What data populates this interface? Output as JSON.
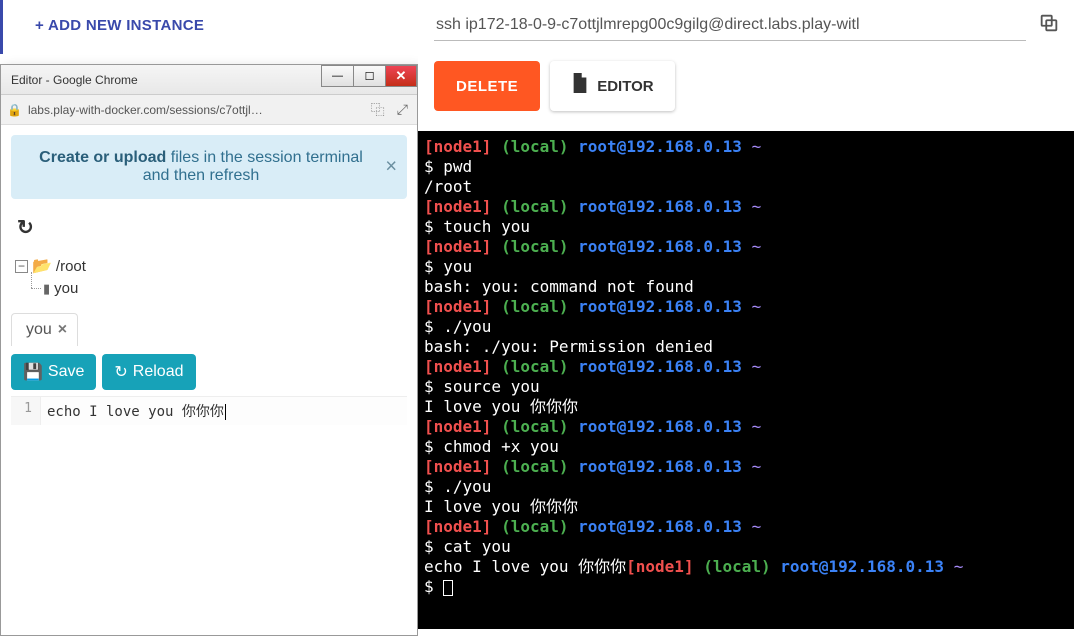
{
  "sidebar": {
    "add_instance": "+ ADD NEW INSTANCE"
  },
  "editor_window": {
    "title": "Editor - Google Chrome",
    "url": "labs.play-with-docker.com/sessions/c7ottjl…",
    "banner_bold": "Create or upload",
    "banner_rest": " files in the session terminal and then refresh",
    "tree_root": "/root",
    "tree_file": "you",
    "tab": "you",
    "save_label": "Save",
    "reload_label": "Reload",
    "line_number": "1",
    "code": "echo I love you 你你你"
  },
  "main": {
    "ssh": "ssh ip172-18-0-9-c7ottjlmrepg00c9gilg@direct.labs.play-witl",
    "delete_label": "DELETE",
    "editor_label": "EDITOR"
  },
  "terminal": {
    "lines": [
      {
        "type": "prompt",
        "node": "[node1]",
        "local": "(local)",
        "user": "root@192.168.0.13",
        "tilde": "~"
      },
      {
        "type": "cmd",
        "text": "$ pwd"
      },
      {
        "type": "out",
        "text": "/root"
      },
      {
        "type": "prompt",
        "node": "[node1]",
        "local": "(local)",
        "user": "root@192.168.0.13",
        "tilde": "~"
      },
      {
        "type": "cmd",
        "text": "$ touch you"
      },
      {
        "type": "prompt",
        "node": "[node1]",
        "local": "(local)",
        "user": "root@192.168.0.13",
        "tilde": "~"
      },
      {
        "type": "cmd",
        "text": "$ you"
      },
      {
        "type": "out",
        "text": "bash: you: command not found"
      },
      {
        "type": "prompt",
        "node": "[node1]",
        "local": "(local)",
        "user": "root@192.168.0.13",
        "tilde": "~"
      },
      {
        "type": "cmd",
        "text": "$ ./you"
      },
      {
        "type": "out",
        "text": "bash: ./you: Permission denied"
      },
      {
        "type": "prompt",
        "node": "[node1]",
        "local": "(local)",
        "user": "root@192.168.0.13",
        "tilde": "~"
      },
      {
        "type": "cmd",
        "text": "$ source you"
      },
      {
        "type": "out",
        "text": "I love you 你你你"
      },
      {
        "type": "prompt",
        "node": "[node1]",
        "local": "(local)",
        "user": "root@192.168.0.13",
        "tilde": "~"
      },
      {
        "type": "cmd",
        "text": "$ chmod +x you"
      },
      {
        "type": "prompt",
        "node": "[node1]",
        "local": "(local)",
        "user": "root@192.168.0.13",
        "tilde": "~"
      },
      {
        "type": "cmd",
        "text": "$ ./you"
      },
      {
        "type": "out",
        "text": "I love you 你你你"
      },
      {
        "type": "prompt",
        "node": "[node1]",
        "local": "(local)",
        "user": "root@192.168.0.13",
        "tilde": "~"
      },
      {
        "type": "cmd",
        "text": "$ cat you"
      },
      {
        "type": "inline",
        "prefix": "echo I love you 你你你",
        "node": "[node1]",
        "local": "(local)",
        "user": "root@192.168.0.13",
        "tilde": "~"
      },
      {
        "type": "cursor",
        "text": "$ "
      }
    ]
  }
}
